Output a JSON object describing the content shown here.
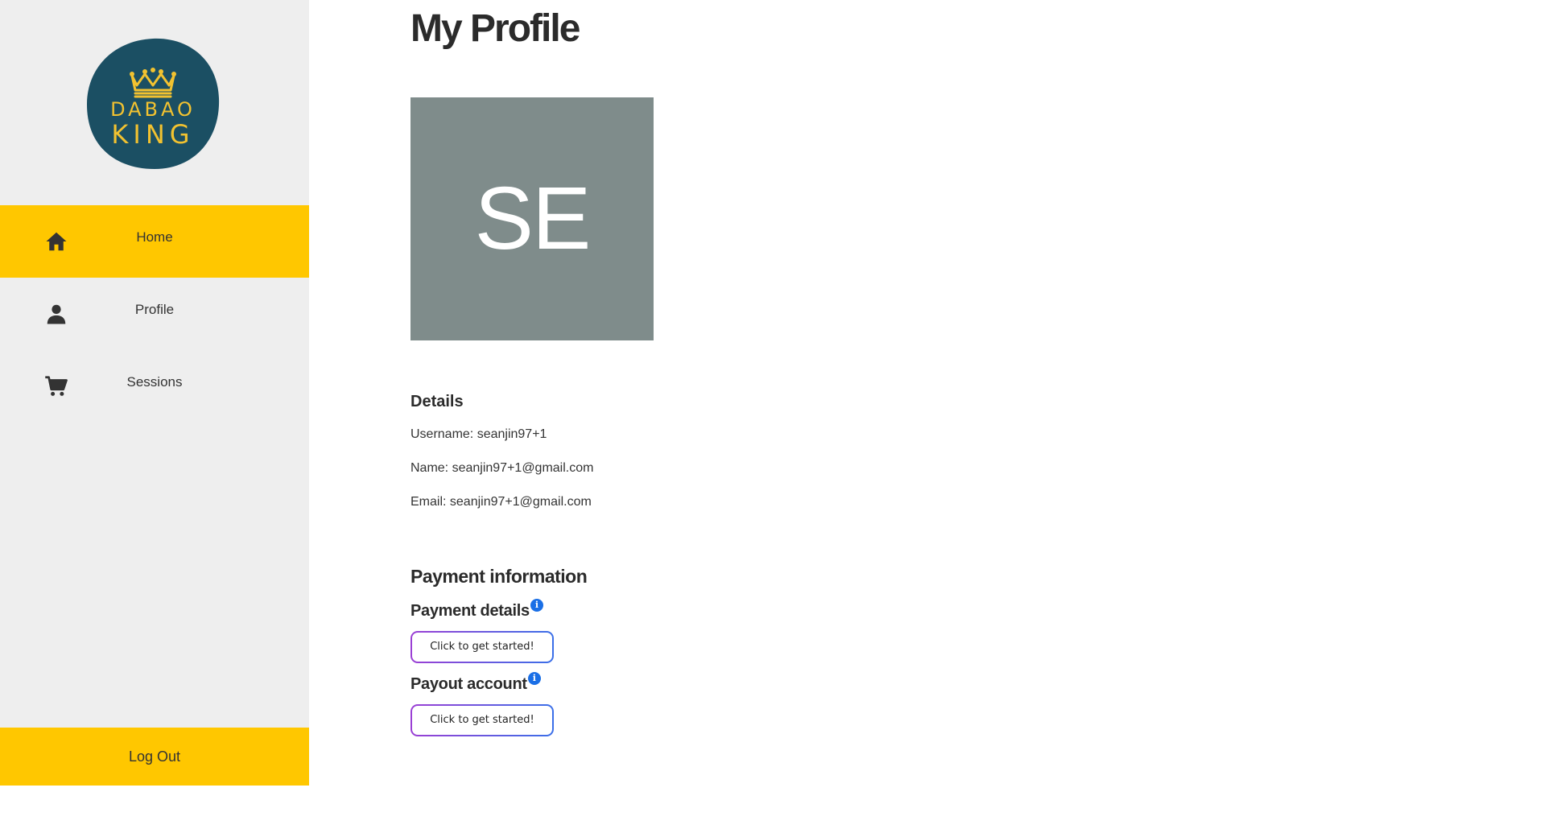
{
  "brand": {
    "logo_line1": "DABAO",
    "logo_line2": "KING",
    "logo_bg": "#1b4f63",
    "logo_fg": "#f2c230"
  },
  "colors": {
    "accent": "#ffc700",
    "sidebar_bg": "#eeeeee",
    "avatar_bg": "#7f8c8b",
    "info_blue": "#1a6fe6"
  },
  "sidebar": {
    "items": [
      {
        "label": "Home",
        "icon": "home-icon",
        "active": true
      },
      {
        "label": "Profile",
        "icon": "user-icon",
        "active": false
      },
      {
        "label": "Sessions",
        "icon": "cart-icon",
        "active": false
      }
    ],
    "logout_label": "Log Out"
  },
  "main": {
    "title": "My Profile",
    "avatar_initials": "SE",
    "details": {
      "heading": "Details",
      "username": "Username: seanjin97+1",
      "name": "Name: seanjin97+1@gmail.com",
      "email": "Email: seanjin97+1@gmail.com"
    },
    "payment": {
      "heading": "Payment information",
      "payment_details_label": "Payment details",
      "payment_details_button": "Click to get started!",
      "payout_account_label": "Payout account",
      "payout_account_button": "Click to get started!",
      "info_glyph": "i"
    }
  }
}
